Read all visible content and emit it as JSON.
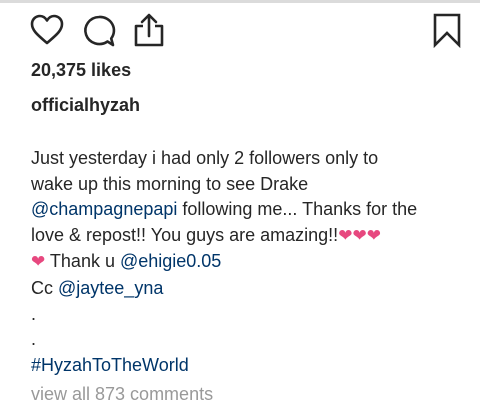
{
  "post": {
    "likes": "20,375 likes",
    "username": "officialhyzah",
    "caption": {
      "line1": "Just yesterday i had only 2 followers only to",
      "line2": "wake up this morning to see Drake",
      "line3_mention": "@champagnepapi",
      "line3_rest": " following me... Thanks for the",
      "line4_text": "love & repost!! You guys are amazing!!",
      "heart_glyph": "❤",
      "line5_text": " Thank u ",
      "line5_mention": "@ehigie0.05",
      "line6_text": "Cc ",
      "line6_mention": "@jaytee_yna",
      "dot1": ".",
      "dot2": ".",
      "hashtag": "#HyzahToTheWorld"
    },
    "view_comments": "view all 873 comments"
  },
  "icons": {
    "like": "heart-outline-icon",
    "comment": "speech-bubble-icon",
    "share": "share-upload-icon",
    "save": "bookmark-icon"
  },
  "colors": {
    "text": "#262626",
    "link": "#003569",
    "muted": "#999999",
    "heart": "#e7487f"
  }
}
